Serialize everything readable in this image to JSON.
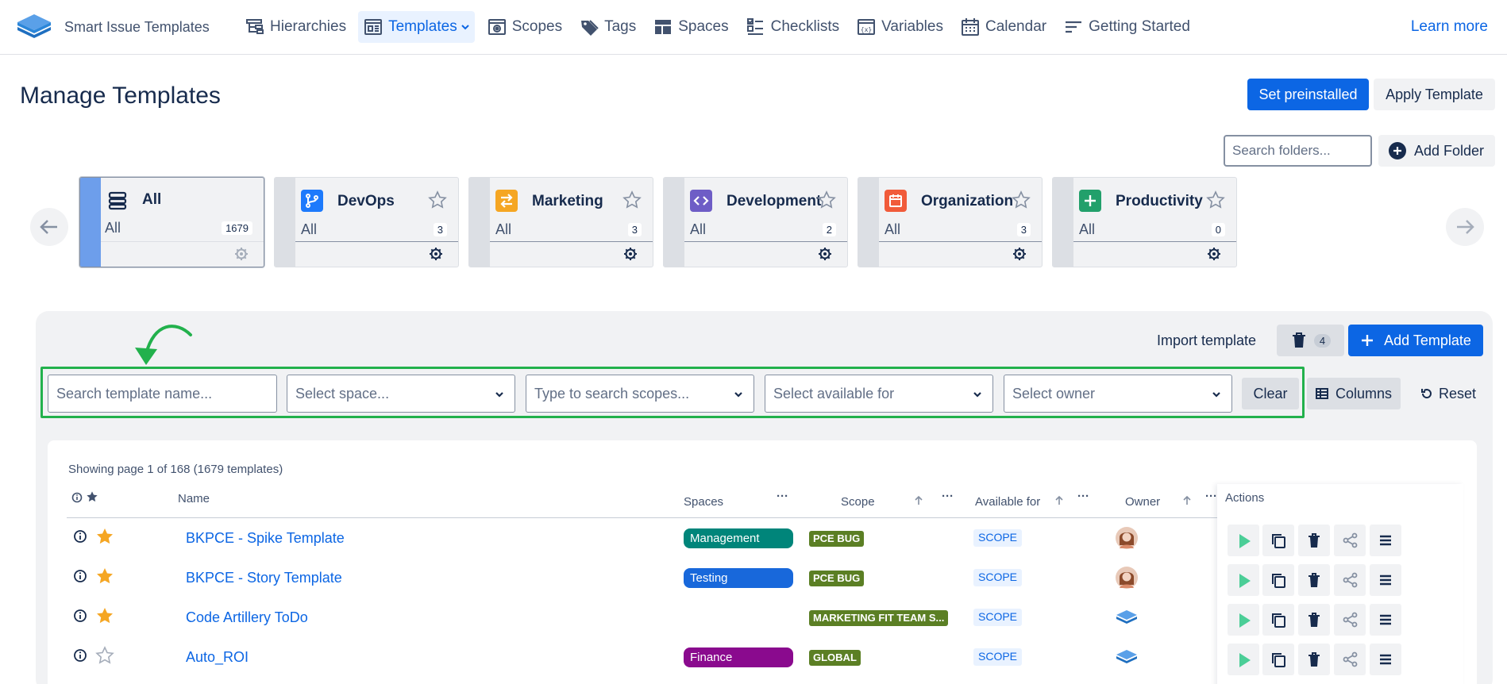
{
  "app": {
    "name": "Smart Issue Templates",
    "learn_more": "Learn more"
  },
  "nav": {
    "items": [
      {
        "label": "Hierarchies",
        "icon": "hierarchy-icon"
      },
      {
        "label": "Templates",
        "icon": "templates-icon",
        "active": true
      },
      {
        "label": "Scopes",
        "icon": "scopes-icon"
      },
      {
        "label": "Tags",
        "icon": "tag-icon"
      },
      {
        "label": "Spaces",
        "icon": "spaces-icon"
      },
      {
        "label": "Checklists",
        "icon": "checklist-icon"
      },
      {
        "label": "Variables",
        "icon": "variables-icon"
      },
      {
        "label": "Calendar",
        "icon": "calendar-icon"
      },
      {
        "label": "Getting Started",
        "icon": "getting-started-icon"
      }
    ]
  },
  "header": {
    "title": "Manage Templates",
    "set_preinstalled": "Set preinstalled",
    "apply_template": "Apply Template"
  },
  "folders": {
    "search_placeholder": "Search folders...",
    "add_folder": "Add Folder",
    "items": [
      {
        "name": "All",
        "sub": "All",
        "count": "1679",
        "color": "#172b4d",
        "icon": "stack-icon"
      },
      {
        "name": "DevOps",
        "sub": "All",
        "count": "3",
        "color": "#1d7afc",
        "icon": "branch-icon"
      },
      {
        "name": "Marketing",
        "sub": "All",
        "count": "3",
        "color": "#f5a623",
        "icon": "swap-icon"
      },
      {
        "name": "Development",
        "sub": "All",
        "count": "2",
        "color": "#6e5dc6",
        "icon": "code-icon"
      },
      {
        "name": "Organization",
        "sub": "All",
        "count": "3",
        "color": "#f15b3a",
        "icon": "calendar-icon"
      },
      {
        "name": "Productivity",
        "sub": "All",
        "count": "0",
        "color": "#22a06b",
        "icon": "plus-icon"
      }
    ]
  },
  "toolbar": {
    "import_template": "Import template",
    "trash_count": "4",
    "add_template": "Add Template",
    "columns": "Columns",
    "reset": "Reset",
    "clear": "Clear"
  },
  "filters": {
    "search_name": "Search template name...",
    "select_space": "Select space...",
    "search_scopes": "Type to search scopes...",
    "available_for": "Select available for",
    "owner": "Select owner"
  },
  "table": {
    "showing": "Showing page 1 of 168 (1679 templates)",
    "columns": {
      "name": "Name",
      "spaces": "Spaces",
      "scope": "Scope",
      "available_for": "Available for",
      "owner": "Owner",
      "actions": "Actions"
    },
    "rows": [
      {
        "name": "BKPCE - Spike Template",
        "starred": true,
        "space": "Management",
        "space_color": "#00857a",
        "scope": "PCE BUG",
        "available": "SCOPE",
        "owner": "avatar-woman"
      },
      {
        "name": "BKPCE - Story Template",
        "starred": true,
        "space": "Testing",
        "space_color": "#1868db",
        "scope": "PCE BUG",
        "available": "SCOPE",
        "owner": "avatar-woman"
      },
      {
        "name": "Code Artillery ToDo",
        "starred": true,
        "space": "",
        "space_color": "",
        "scope": "MARKETING FIT TEAM S...",
        "available": "SCOPE",
        "owner": "app-logo"
      },
      {
        "name": "Auto_ROI",
        "starred": false,
        "space": "Finance",
        "space_color": "#8a0a8e",
        "scope": "GLOBAL",
        "available": "SCOPE",
        "owner": "app-logo"
      }
    ]
  },
  "colors": {
    "accent": "#0c66e4",
    "highlight": "#22b14c",
    "star": "#f5a623"
  }
}
